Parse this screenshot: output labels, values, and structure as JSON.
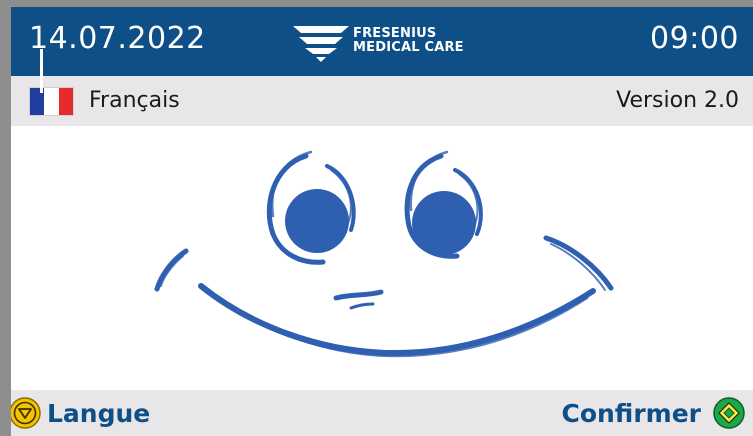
{
  "header": {
    "date": "14.07.2022",
    "time": "09:00",
    "logo": {
      "line1": "FRESENIUS",
      "line2": "MEDICAL CARE"
    }
  },
  "infobar": {
    "language": "Français",
    "flag": [
      "#1f3fa0",
      "#ffffff",
      "#e52b2b"
    ],
    "version": "Version 2.0"
  },
  "content": {
    "illustration": "smiley-face"
  },
  "footer": {
    "left_label": "Langue",
    "left_icon": "down-arrow-key-icon",
    "left_icon_color": "#f5c400",
    "right_label": "Confirmer",
    "right_icon": "confirm-key-icon",
    "right_icon_color": "#1aa84b"
  },
  "colors": {
    "header_bg": "#0d4f86",
    "bar_bg": "#e9e6ea",
    "accent_text": "#0d4f86",
    "smiley": "#2f5fb0"
  }
}
